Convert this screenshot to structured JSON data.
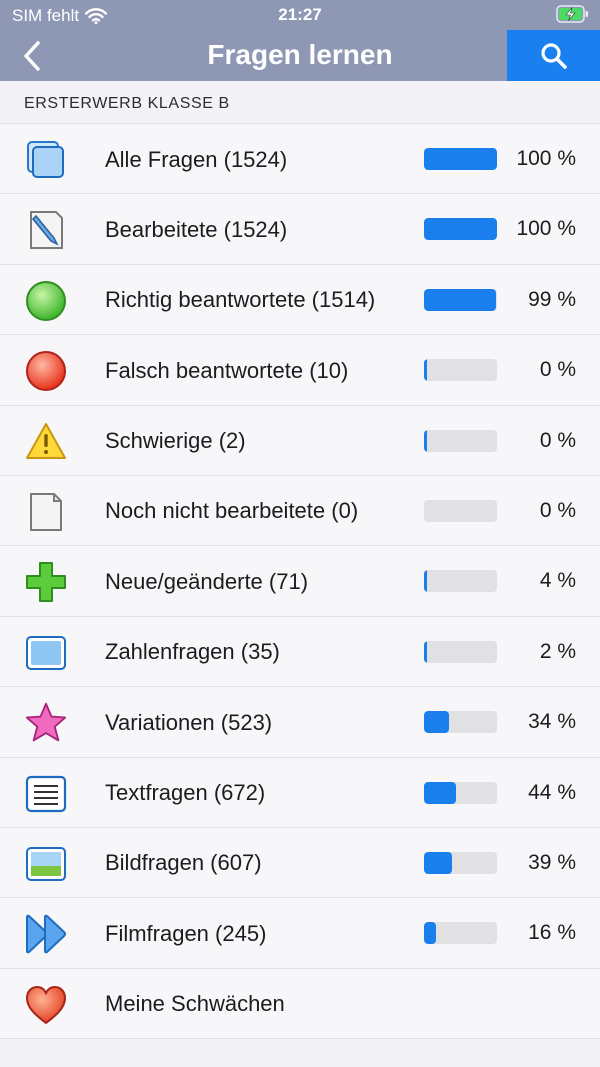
{
  "status_bar": {
    "carrier": "SIM fehlt",
    "time": "21:27"
  },
  "nav": {
    "title": "Fragen lernen"
  },
  "section": {
    "header": "ERSTERWERB KLASSE B"
  },
  "colors": {
    "accent": "#1a80f0",
    "bar_fill": "#1a7fec",
    "bar_track": "#e1e1e4",
    "navbar": "#8e97b4"
  },
  "items": [
    {
      "label": "Alle Fragen (1524)",
      "percent": "100 %",
      "progress": 1.0,
      "icon": "stack-icon"
    },
    {
      "label": "Bearbeitete (1524)",
      "percent": "100 %",
      "progress": 1.0,
      "icon": "edited-document-icon"
    },
    {
      "label": "Richtig beantwortete (1514)",
      "percent": "99 %",
      "progress": 0.99,
      "icon": "green-circle-icon"
    },
    {
      "label": "Falsch beantwortete (10)",
      "percent": "0 %",
      "progress": 0.0,
      "icon": "red-circle-icon"
    },
    {
      "label": "Schwierige (2)",
      "percent": "0 %",
      "progress": 0.0,
      "icon": "warning-icon"
    },
    {
      "label": "Noch nicht bearbeitete (0)",
      "percent": "0 %",
      "progress": 0.0,
      "icon": "blank-document-icon"
    },
    {
      "label": "Neue/geänderte (71)",
      "percent": "4 %",
      "progress": 0.04,
      "icon": "green-plus-icon"
    },
    {
      "label": "Zahlenfragen (35)",
      "percent": "2 %",
      "progress": 0.02,
      "icon": "number-box-icon"
    },
    {
      "label": "Variationen (523)",
      "percent": "34 %",
      "progress": 0.34,
      "icon": "pink-star-icon"
    },
    {
      "label": "Textfragen (672)",
      "percent": "44 %",
      "progress": 0.44,
      "icon": "text-lines-icon"
    },
    {
      "label": "Bildfragen (607)",
      "percent": "39 %",
      "progress": 0.39,
      "icon": "picture-icon"
    },
    {
      "label": "Filmfragen (245)",
      "percent": "16 %",
      "progress": 0.16,
      "icon": "fast-forward-icon"
    },
    {
      "label": "Meine Schwächen",
      "icon": "heart-icon"
    }
  ]
}
